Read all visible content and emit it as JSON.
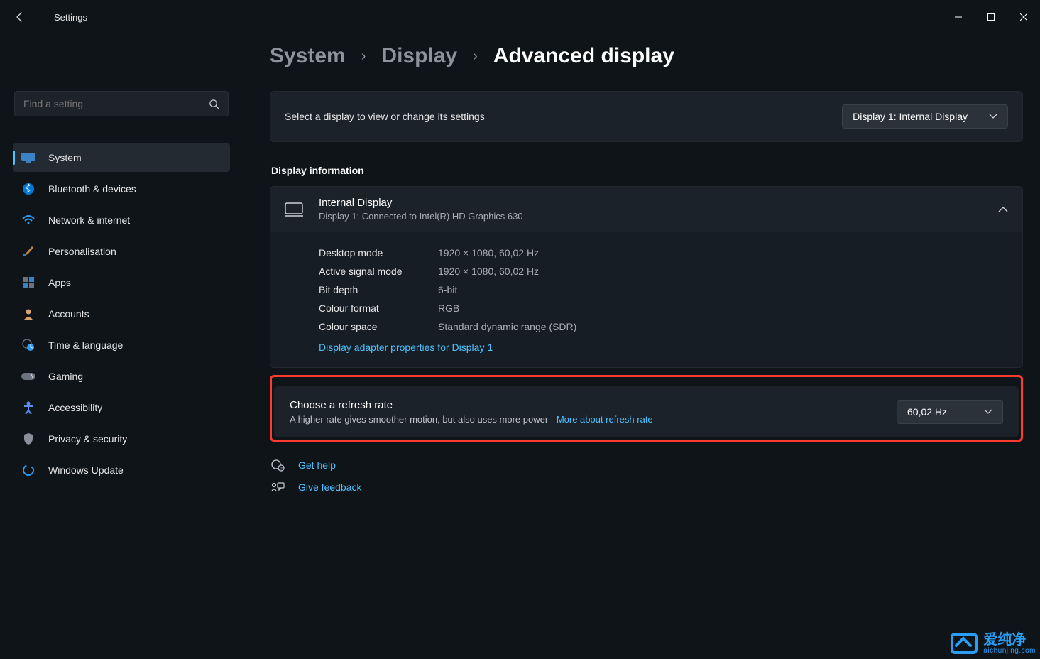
{
  "app": {
    "title": "Settings"
  },
  "search": {
    "placeholder": "Find a setting"
  },
  "sidebar": {
    "items": [
      {
        "label": "System"
      },
      {
        "label": "Bluetooth & devices"
      },
      {
        "label": "Network & internet"
      },
      {
        "label": "Personalisation"
      },
      {
        "label": "Apps"
      },
      {
        "label": "Accounts"
      },
      {
        "label": "Time & language"
      },
      {
        "label": "Gaming"
      },
      {
        "label": "Accessibility"
      },
      {
        "label": "Privacy & security"
      },
      {
        "label": "Windows Update"
      }
    ]
  },
  "breadcrumb": {
    "parent1": "System",
    "parent2": "Display",
    "current": "Advanced display"
  },
  "selectDisplay": {
    "prompt": "Select a display to view or change its settings",
    "value": "Display 1: Internal Display"
  },
  "sections": {
    "displayInfoTitle": "Display information"
  },
  "displayInfo": {
    "title": "Internal Display",
    "subtitle": "Display 1: Connected to Intel(R) HD Graphics 630",
    "rows": [
      {
        "label": "Desktop mode",
        "value": "1920 × 1080, 60,02 Hz"
      },
      {
        "label": "Active signal mode",
        "value": "1920 × 1080, 60,02 Hz"
      },
      {
        "label": "Bit depth",
        "value": "6-bit"
      },
      {
        "label": "Colour format",
        "value": "RGB"
      },
      {
        "label": "Colour space",
        "value": "Standard dynamic range (SDR)"
      }
    ],
    "adapterLink": "Display adapter properties for Display 1"
  },
  "refreshRate": {
    "title": "Choose a refresh rate",
    "subtitle": "A higher rate gives smoother motion, but also uses more power",
    "link": "More about refresh rate",
    "value": "60,02 Hz"
  },
  "help": {
    "getHelp": "Get help",
    "giveFeedback": "Give feedback"
  },
  "watermark": {
    "cn": "爱纯净",
    "url": "aichunjing.com"
  }
}
